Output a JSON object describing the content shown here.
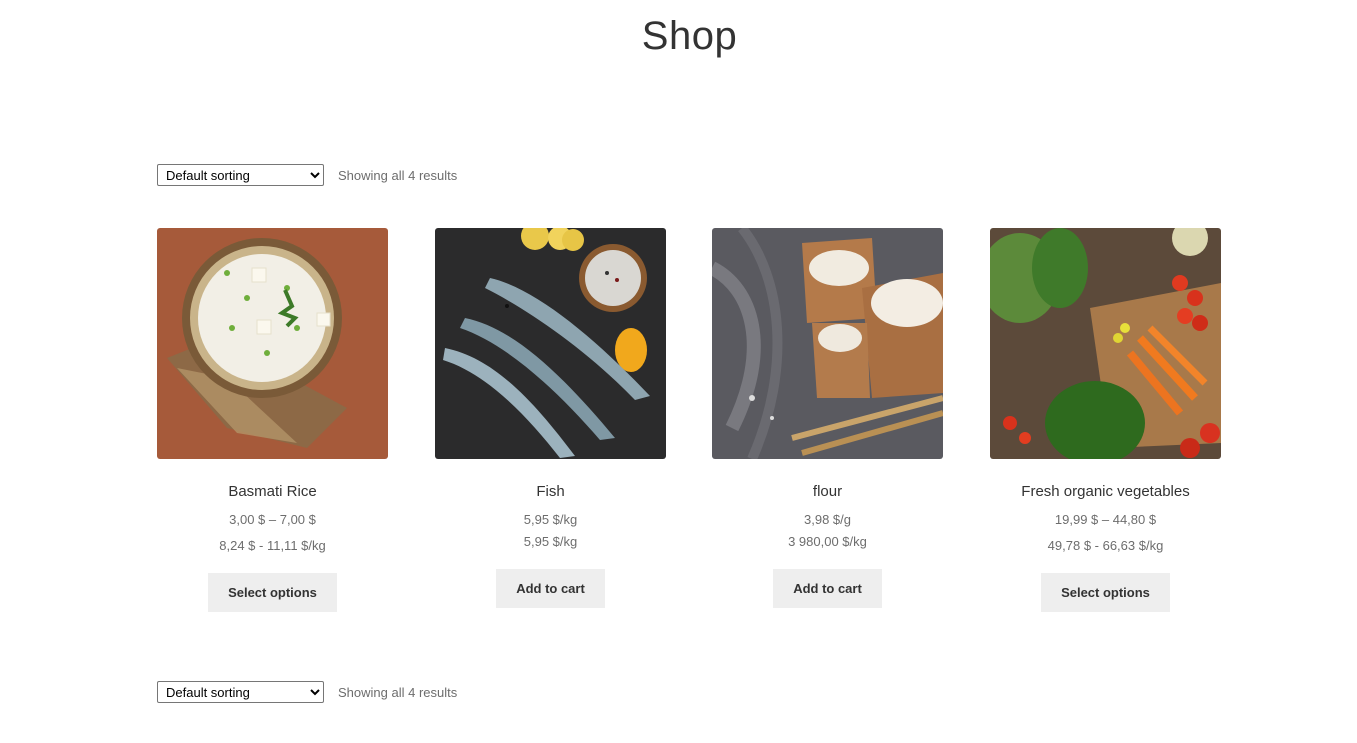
{
  "page": {
    "title": "Shop"
  },
  "toolbar": {
    "sorting_selected": "Default sorting",
    "result_count": "Showing all 4 results"
  },
  "products": [
    {
      "name": "Basmati Rice",
      "price": "3,00 $ – 7,00 $",
      "unit_price": "8,24 $ - 11,11 $/kg",
      "button": "Select options"
    },
    {
      "name": "Fish",
      "price": "5,95 $/kg",
      "unit_price": "5,95 $/kg",
      "button": "Add to cart"
    },
    {
      "name": "flour",
      "price": "3,98 $/g",
      "unit_price": "3 980,00 $/kg",
      "button": "Add to cart"
    },
    {
      "name": "Fresh organic vegetables",
      "price": "19,99 $ – 44,80 $",
      "unit_price": "49,78 $ - 66,63 $/kg",
      "button": "Select options"
    }
  ]
}
